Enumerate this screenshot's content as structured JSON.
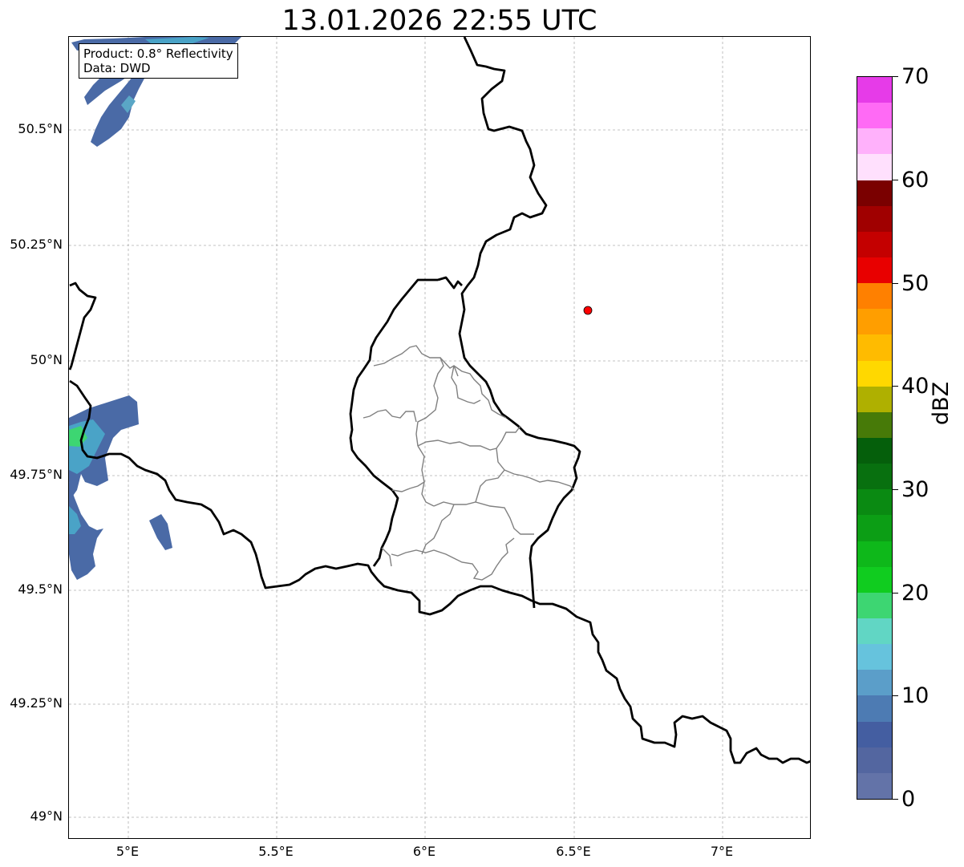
{
  "title": "13.01.2026 22:55 UTC",
  "info": {
    "product_line": "Product: 0.8° Reflectivity",
    "data_line": "Data: DWD"
  },
  "axes": {
    "lat_ticks": [
      "50.5°N",
      "50.25°N",
      "50°N",
      "49.75°N",
      "49.5°N",
      "49.25°N",
      "49°N"
    ],
    "lon_ticks": [
      "5°E",
      "5.5°E",
      "6°E",
      "6.5°E",
      "7°E"
    ]
  },
  "marker": {
    "label": "radar-site",
    "lon": 6.55,
    "lat": 50.11,
    "color": "#ff0000"
  },
  "colorbar": {
    "unit": "dBZ",
    "min": 0,
    "max": 70,
    "tick_labels": [
      "70",
      "60",
      "50",
      "40",
      "30",
      "20",
      "10",
      "0"
    ],
    "colors_top_to_bottom": [
      "#e63be8",
      "#ff6af5",
      "#ffb1fb",
      "#ffe0fd",
      "#7a0000",
      "#a00000",
      "#c40000",
      "#e80000",
      "#ff8000",
      "#ff9e00",
      "#ffbb00",
      "#ffd800",
      "#afb000",
      "#477a08",
      "#055f0b",
      "#08700f",
      "#0a8a12",
      "#0c9e15",
      "#0eb81a",
      "#10cc1f",
      "#3dd672",
      "#61d6c4",
      "#66c3dd",
      "#5b9ec9",
      "#4d7bb3",
      "#445ea1",
      "#5366a0",
      "#6373a8"
    ]
  }
}
